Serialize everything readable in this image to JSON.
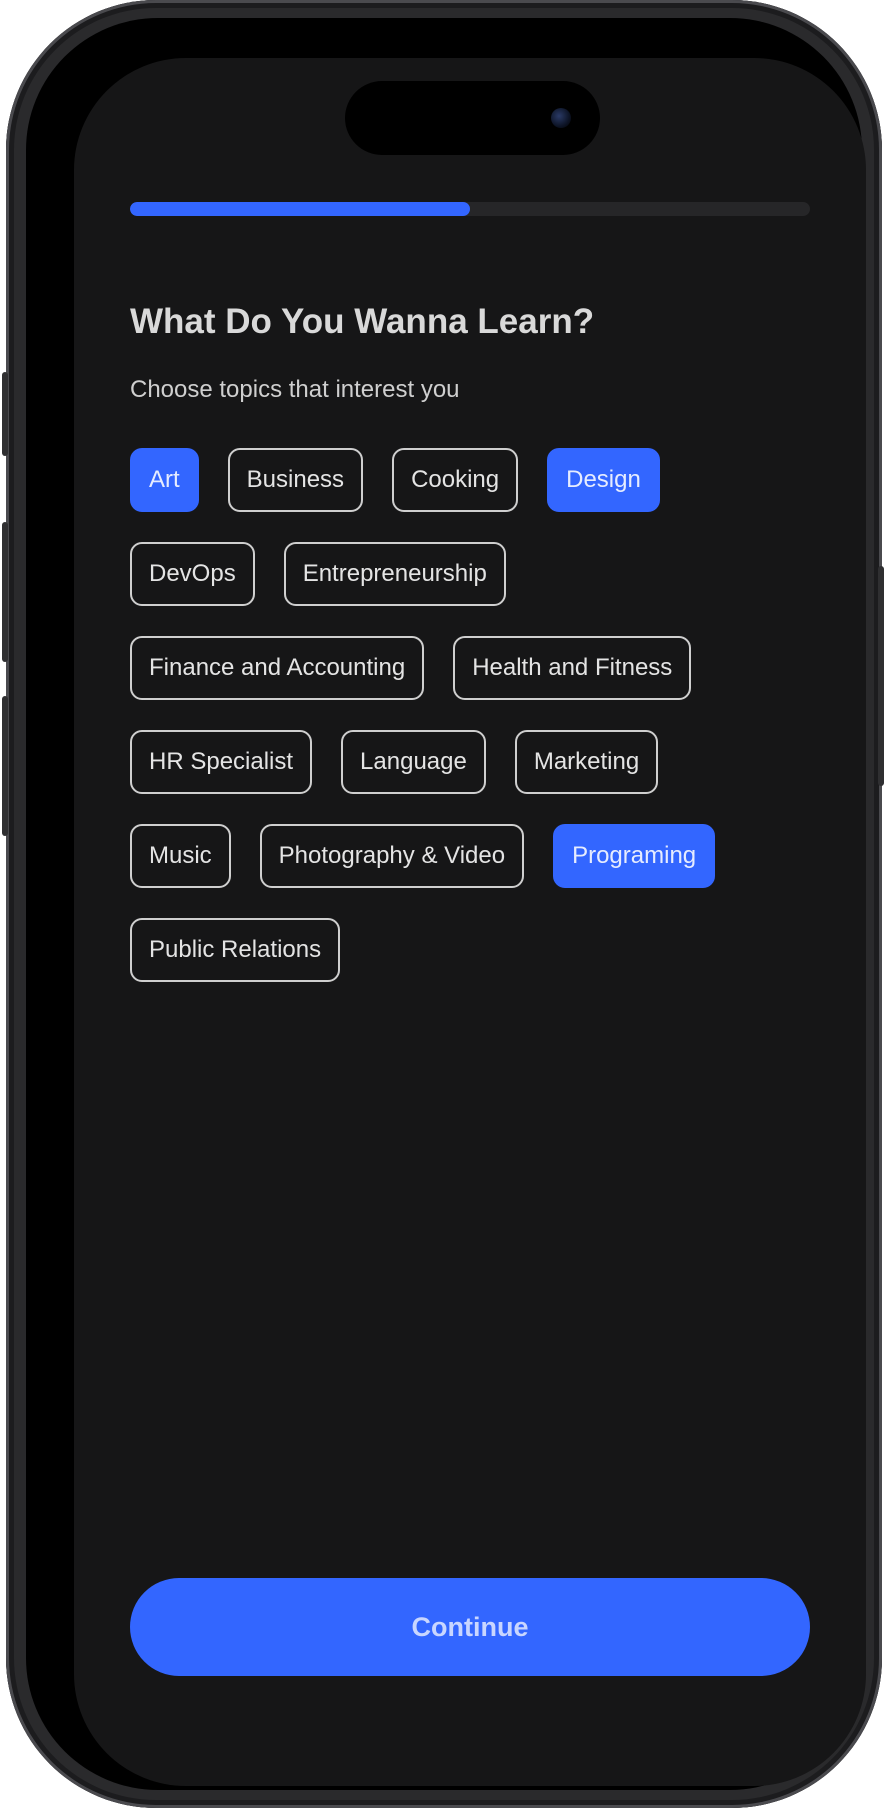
{
  "progress": {
    "fraction": 0.5
  },
  "header": {
    "title": "What Do You Wanna Learn?",
    "subtitle": "Choose topics that interest you"
  },
  "topics": [
    {
      "label": "Art",
      "selected": true
    },
    {
      "label": "Business",
      "selected": false
    },
    {
      "label": "Cooking",
      "selected": false
    },
    {
      "label": "Design",
      "selected": true
    },
    {
      "label": "DevOps",
      "selected": false
    },
    {
      "label": "Entrepreneurship",
      "selected": false
    },
    {
      "label": "Finance and Accounting",
      "selected": false
    },
    {
      "label": "Health and Fitness",
      "selected": false
    },
    {
      "label": "HR Specialist",
      "selected": false
    },
    {
      "label": "Language",
      "selected": false
    },
    {
      "label": "Marketing",
      "selected": false
    },
    {
      "label": "Music",
      "selected": false
    },
    {
      "label": "Photography & Video",
      "selected": false
    },
    {
      "label": "Programing",
      "selected": true
    },
    {
      "label": "Public Relations",
      "selected": false
    }
  ],
  "footer": {
    "continue_label": "Continue"
  },
  "colors": {
    "accent": "#3366ff",
    "background": "#161617",
    "chip_border": "#cfcfcf",
    "track": "#262628"
  }
}
